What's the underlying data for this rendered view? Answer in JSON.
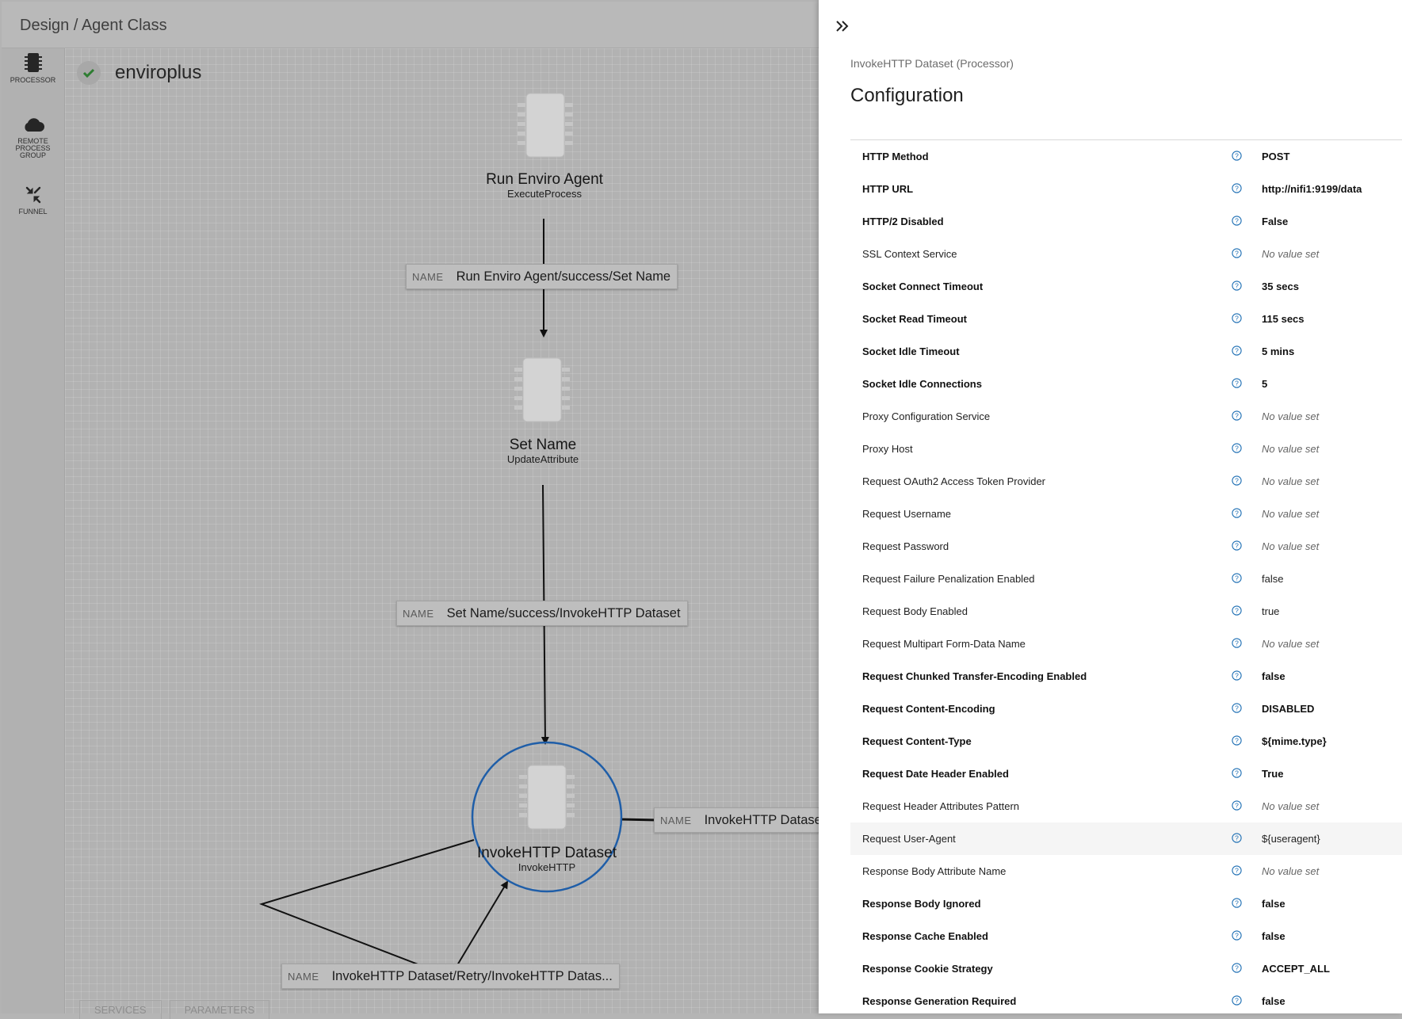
{
  "breadcrumb": "Design / Agent Class",
  "toolbar": {
    "processor_label": "PROCESSOR",
    "rpg_label_1": "REMOTE",
    "rpg_label_2": "PROCESS",
    "rpg_label_3": "GROUP",
    "funnel_label": "FUNNEL"
  },
  "flow": {
    "name": "enviroplus",
    "status": "valid"
  },
  "processors": [
    {
      "name": "Run Enviro Agent",
      "type": "ExecuteProcess"
    },
    {
      "name": "Set Name",
      "type": "UpdateAttribute"
    },
    {
      "name": "InvokeHTTP Dataset",
      "type": "InvokeHTTP",
      "selected": true
    }
  ],
  "connections": [
    {
      "key": "NAME",
      "value": "Run Enviro Agent/success/Set Name"
    },
    {
      "key": "NAME",
      "value": "Set Name/success/InvokeHTTP Dataset"
    },
    {
      "key": "NAME",
      "value": "InvokeHTTP Dataset/Retry/InvokeHTTP Datas..."
    },
    {
      "key": "NAME",
      "value": "InvokeHTTP Datase"
    }
  ],
  "bottom_tabs": [
    "SERVICES",
    "PARAMETERS"
  ],
  "panel": {
    "subtitle": "InvokeHTTP Dataset (Processor)",
    "title": "Configuration",
    "properties": [
      {
        "name": "HTTP Method",
        "value": "POST",
        "required": true,
        "set": true
      },
      {
        "name": "HTTP URL",
        "value": "http://nifi1:9199/data",
        "required": true,
        "set": true
      },
      {
        "name": "HTTP/2 Disabled",
        "value": "False",
        "required": true,
        "set": true
      },
      {
        "name": "SSL Context Service",
        "value": "No value set",
        "required": false,
        "set": false
      },
      {
        "name": "Socket Connect Timeout",
        "value": "35 secs",
        "required": true,
        "set": true
      },
      {
        "name": "Socket Read Timeout",
        "value": "115 secs",
        "required": true,
        "set": true
      },
      {
        "name": "Socket Idle Timeout",
        "value": "5 mins",
        "required": true,
        "set": true
      },
      {
        "name": "Socket Idle Connections",
        "value": "5",
        "required": true,
        "set": true
      },
      {
        "name": "Proxy Configuration Service",
        "value": "No value set",
        "required": false,
        "set": false
      },
      {
        "name": "Proxy Host",
        "value": "No value set",
        "required": false,
        "set": false
      },
      {
        "name": "Request OAuth2 Access Token Provider",
        "value": "No value set",
        "required": false,
        "set": false
      },
      {
        "name": "Request Username",
        "value": "No value set",
        "required": false,
        "set": false
      },
      {
        "name": "Request Password",
        "value": "No value set",
        "required": false,
        "set": false
      },
      {
        "name": "Request Failure Penalization Enabled",
        "value": "false",
        "required": false,
        "set": true
      },
      {
        "name": "Request Body Enabled",
        "value": "true",
        "required": false,
        "set": true
      },
      {
        "name": "Request Multipart Form-Data Name",
        "value": "No value set",
        "required": false,
        "set": false
      },
      {
        "name": "Request Chunked Transfer-Encoding Enabled",
        "value": "false",
        "required": true,
        "set": true
      },
      {
        "name": "Request Content-Encoding",
        "value": "DISABLED",
        "required": true,
        "set": true
      },
      {
        "name": "Request Content-Type",
        "value": "${mime.type}",
        "required": true,
        "set": true
      },
      {
        "name": "Request Date Header Enabled",
        "value": "True",
        "required": true,
        "set": true
      },
      {
        "name": "Request Header Attributes Pattern",
        "value": "No value set",
        "required": false,
        "set": false
      },
      {
        "name": "Request User-Agent",
        "value": "${useragent}",
        "required": false,
        "set": true,
        "hover": true
      },
      {
        "name": "Response Body Attribute Name",
        "value": "No value set",
        "required": false,
        "set": false
      },
      {
        "name": "Response Body Ignored",
        "value": "false",
        "required": true,
        "set": true
      },
      {
        "name": "Response Cache Enabled",
        "value": "false",
        "required": true,
        "set": true
      },
      {
        "name": "Response Cookie Strategy",
        "value": "ACCEPT_ALL",
        "required": true,
        "set": true
      },
      {
        "name": "Response Generation Required",
        "value": "false",
        "required": true,
        "set": true
      }
    ]
  },
  "colors": {
    "selection": "#1f5ea8",
    "help_icon": "#1e6fb4",
    "check": "#2e7d32"
  }
}
